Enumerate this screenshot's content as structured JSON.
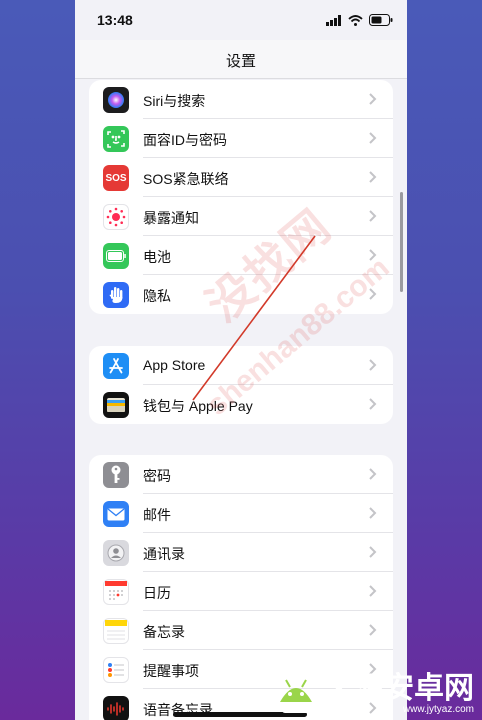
{
  "status_bar": {
    "time": "13:48"
  },
  "nav": {
    "title": "设置"
  },
  "groups": [
    {
      "items": [
        {
          "label": "Siri与搜索",
          "icon": "siri-icon",
          "color": "#1c1c1e"
        },
        {
          "label": "面容ID与密码",
          "icon": "face-id-icon",
          "color": "#34c759"
        },
        {
          "label": "SOS紧急联络",
          "icon": "sos-icon",
          "icon_text": "SOS",
          "color": "#e53935"
        },
        {
          "label": "暴露通知",
          "icon": "exposure-icon",
          "color": "#ffffff"
        },
        {
          "label": "电池",
          "icon": "battery-icon",
          "color": "#34c759"
        },
        {
          "label": "隐私",
          "icon": "hand-icon",
          "color": "#2f6bf5"
        }
      ]
    },
    {
      "items": [
        {
          "label": "App Store",
          "icon": "app-store-icon",
          "color": "#1e8ef5"
        },
        {
          "label": "钱包与 Apple Pay",
          "icon": "wallet-icon",
          "color": "#111111"
        }
      ]
    },
    {
      "items": [
        {
          "label": "密码",
          "icon": "key-icon",
          "color": "#8e8e93"
        },
        {
          "label": "邮件",
          "icon": "mail-icon",
          "color": "#2f80f5"
        },
        {
          "label": "通讯录",
          "icon": "contacts-icon",
          "color": "#d9d9de"
        },
        {
          "label": "日历",
          "icon": "calendar-icon",
          "color": "#ffffff"
        },
        {
          "label": "备忘录",
          "icon": "notes-icon",
          "color": "#ffffff"
        },
        {
          "label": "提醒事项",
          "icon": "reminders-icon",
          "color": "#ffffff"
        },
        {
          "label": "语音备忘录",
          "icon": "voice-memos-icon",
          "color": "#111111"
        }
      ]
    }
  ],
  "watermark": {
    "text": "没找网",
    "url": "shenhan88.com"
  },
  "brand": {
    "name": "天源安卓网",
    "url": "www.jytyaz.com"
  }
}
